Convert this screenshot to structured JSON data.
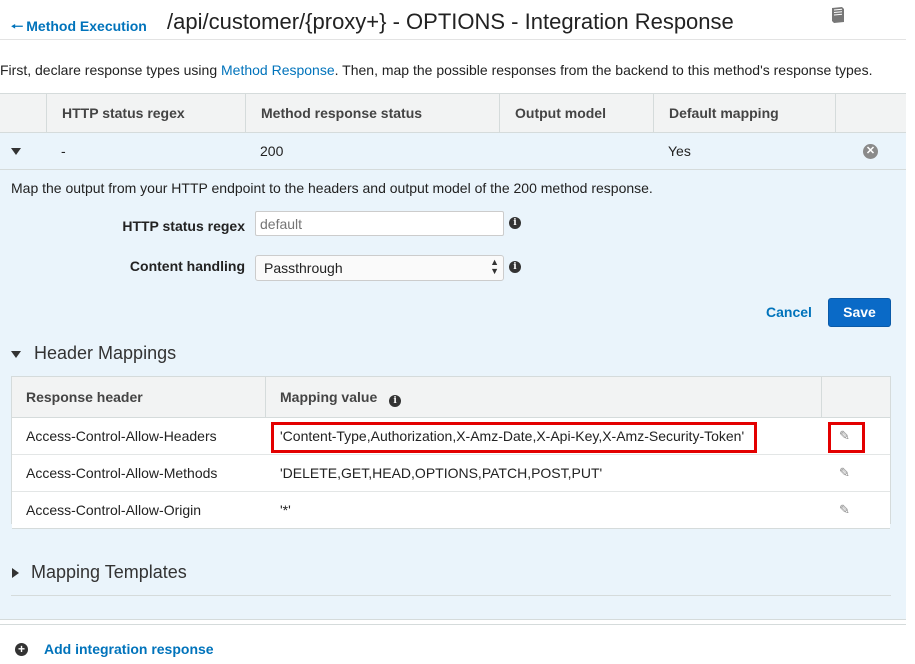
{
  "header": {
    "back_label": "Method Execution",
    "title": "/api/customer/{proxy+} - OPTIONS - Integration Response"
  },
  "intro": {
    "before": "First, declare response types using ",
    "link": "Method Response",
    "after": ". Then, map the possible responses from the backend to this method's response types."
  },
  "table": {
    "columns": [
      "HTTP status regex",
      "Method response status",
      "Output model",
      "Default mapping"
    ],
    "row": {
      "status_regex": "-",
      "method_status": "200",
      "output_model": "",
      "default_mapping": "Yes"
    }
  },
  "detail": {
    "intro": "Map the output from your HTTP endpoint to the headers and output model of the 200 method response.",
    "status_regex_label": "HTTP status regex",
    "status_regex_placeholder": "default",
    "content_handling_label": "Content handling",
    "content_handling_value": "Passthrough",
    "cancel_label": "Cancel",
    "save_label": "Save"
  },
  "header_mappings": {
    "title": "Header Mappings",
    "columns": [
      "Response header",
      "Mapping value"
    ],
    "rows": [
      {
        "header": "Access-Control-Allow-Headers",
        "value": "'Content-Type,Authorization,X-Amz-Date,X-Api-Key,X-Amz-Security-Token'"
      },
      {
        "header": "Access-Control-Allow-Methods",
        "value": "'DELETE,GET,HEAD,OPTIONS,PATCH,POST,PUT'"
      },
      {
        "header": "Access-Control-Allow-Origin",
        "value": "'*'"
      }
    ]
  },
  "mapping_templates": {
    "title": "Mapping Templates"
  },
  "footer": {
    "add_label": "Add integration response"
  },
  "colors": {
    "link": "#0073bb",
    "highlight": "#e30000",
    "primary_button": "#0a6ac7"
  }
}
